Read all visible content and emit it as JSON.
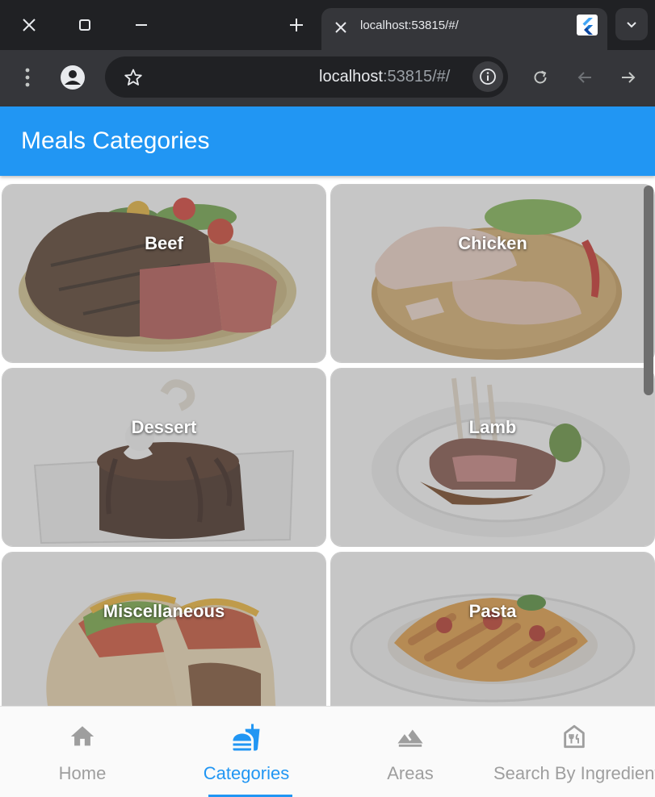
{
  "browser": {
    "tab_title": "localhost:53815/#/",
    "url_host": "localhost",
    "url_rest": ":53815/#/"
  },
  "app": {
    "title": "Meals Categories"
  },
  "categories": [
    {
      "name": "Beef"
    },
    {
      "name": "Chicken"
    },
    {
      "name": "Dessert"
    },
    {
      "name": "Lamb"
    },
    {
      "name": "Miscellaneous"
    },
    {
      "name": "Pasta"
    }
  ],
  "bottom_nav": {
    "items": [
      {
        "label": "Home",
        "icon": "home-icon"
      },
      {
        "label": "Categories",
        "icon": "fastfood-icon"
      },
      {
        "label": "Areas",
        "icon": "landscape-icon"
      },
      {
        "label": "Search By Ingredient",
        "icon": "restaurant-store-icon"
      }
    ],
    "active_index": 1
  },
  "colors": {
    "primary": "#2196f3",
    "inactive": "#9e9e9e"
  }
}
